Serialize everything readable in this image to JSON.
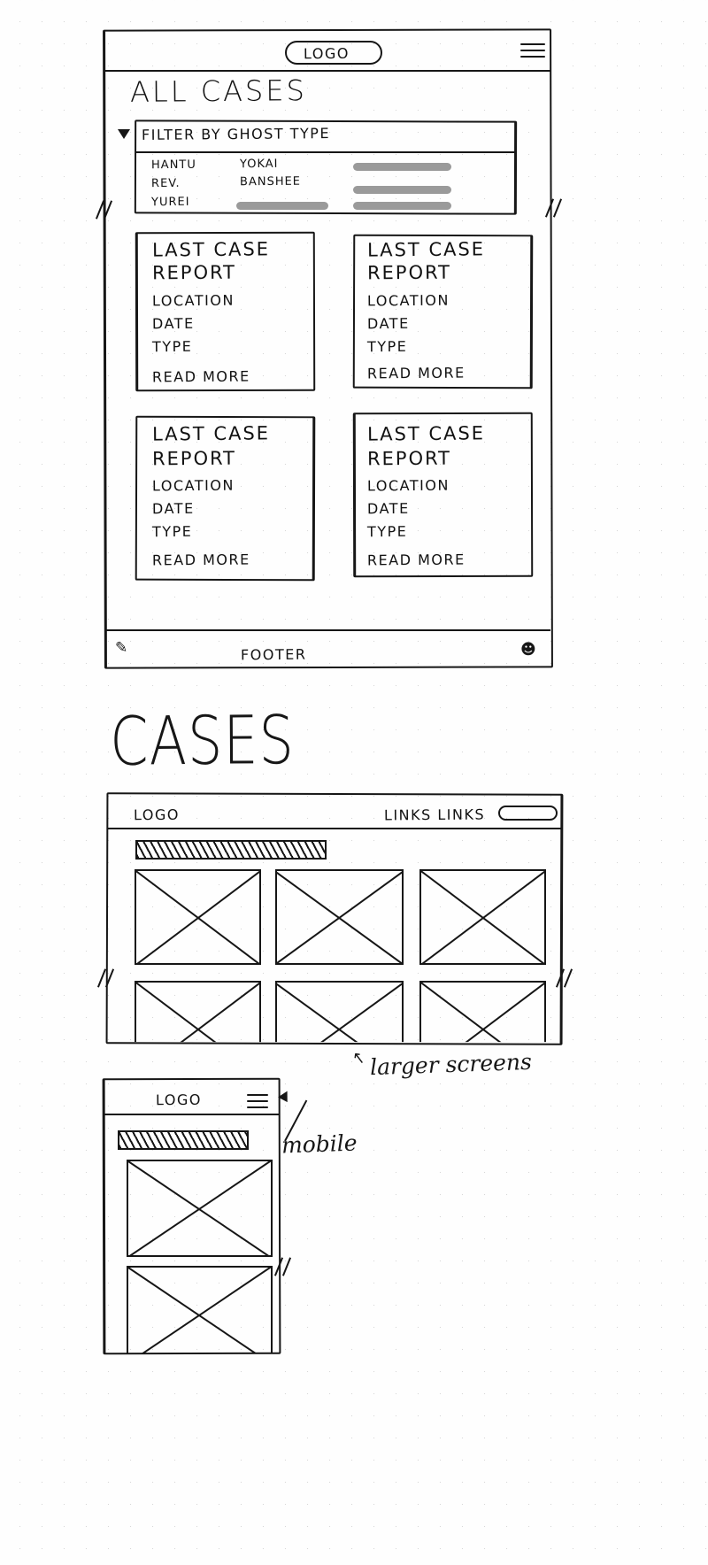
{
  "meta": {
    "sheet_title": "Cases page wireframe sketch"
  },
  "mobile_detail": {
    "topbar": {
      "logo": "LOGO",
      "menu_icon": "hamburger-icon"
    },
    "page_title": "ALL CASES",
    "filter": {
      "caret_icon": "caret-down-icon",
      "label": "FILTER   BY    GHOST TYPE",
      "columns": [
        [
          "HANTU",
          "REV.",
          "YUREI"
        ],
        [
          "YOKAI",
          "BANSHEE",
          ""
        ]
      ],
      "placeholder_bars": 4
    },
    "cards": [
      {
        "title_line1": "LAST CASE",
        "title_line2": "REPORT",
        "fields": [
          "LOCATION",
          "DATE",
          "TYPE"
        ],
        "cta": "READ MORE"
      },
      {
        "title_line1": "LAST CASE",
        "title_line2": "REPORT",
        "fields": [
          "LOCATION",
          "DATE",
          "TYPE"
        ],
        "cta": "READ MORE"
      },
      {
        "title_line1": "LAST CASE",
        "title_line2": "REPORT",
        "fields": [
          "LOCATION",
          "DATE",
          "TYPE"
        ],
        "cta": "READ MORE"
      },
      {
        "title_line1": "LAST CASE",
        "title_line2": "REPORT",
        "fields": [
          "LOCATION",
          "DATE",
          "TYPE"
        ],
        "cta": "READ MORE"
      }
    ],
    "footer": {
      "label": "FOOTER",
      "left_icon": "pen-nib-icon",
      "right_icon": "ghost-icon"
    }
  },
  "section_heading": "CASES",
  "desktop": {
    "topbar": {
      "logo": "LOGO",
      "links": "LINKS LINKS",
      "pill_icon": "search-pill"
    },
    "banner": "hatched-banner",
    "thumbnails_row1": 3,
    "thumbnails_row2": 3,
    "annotation": "larger screens",
    "annotation_marker": "↖"
  },
  "mobile_small": {
    "topbar": {
      "logo": "LOGO",
      "menu_icon": "hamburger-icon"
    },
    "banner": "hatched-banner",
    "thumbnails": 2,
    "annotation": "mobile"
  },
  "colors": {
    "ink": "#161616",
    "placeholder_gray": "#9a9a9a",
    "paper": "#fefefe",
    "grid_dot": "#d8d8d8"
  }
}
